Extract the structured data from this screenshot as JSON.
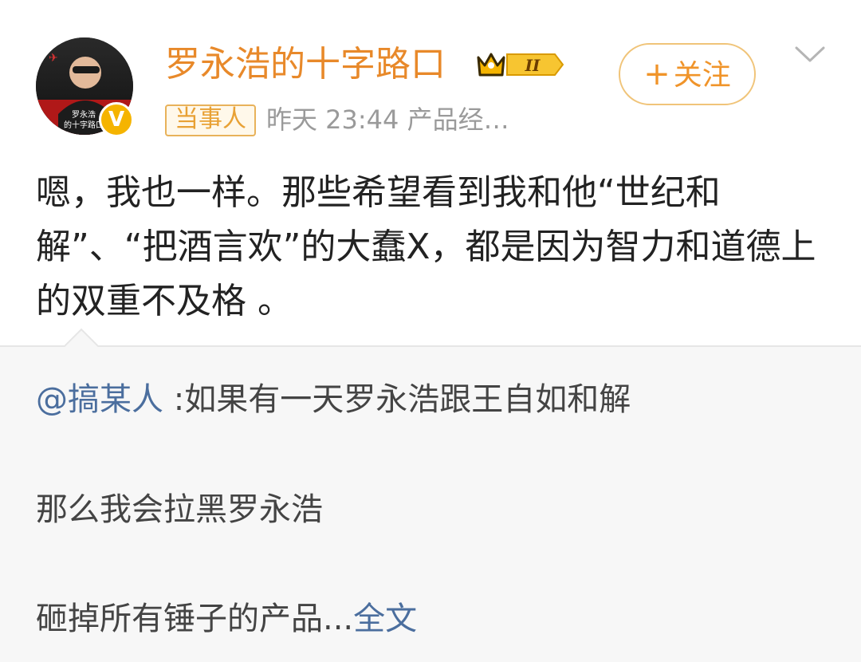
{
  "author": {
    "name": "罗永浩的十字路口",
    "avatar_caption_line1": "罗永浩",
    "avatar_caption_line2": "的十字路口",
    "verified_mark": "V",
    "vip_level": "II",
    "role_tag": "当事人",
    "post_time_source": "昨天 23:44 产品经…"
  },
  "follow": {
    "plus": "+",
    "label": "关注"
  },
  "post": {
    "text": "嗯，我也一样。那些希望看到我和他“世纪和解”、“把酒言欢”的大蠢X，都是因为智力和道德上的双重不及格 。"
  },
  "repost": {
    "mention": "@搞某人",
    "line1_rest": " :如果有一天罗永浩跟王自如和解",
    "line2": "那么我会拉黑罗永浩",
    "line3": "砸掉所有锤子的产品...",
    "full_text_link": "全文"
  },
  "watermark": "",
  "icons": {
    "more": "chevron-down-icon",
    "vip": "crown-icon",
    "verified": "verified-v-icon"
  },
  "colors": {
    "username": "#e8892a",
    "link": "#4b6e9e",
    "tag_border": "#e8b25a",
    "follow_border": "#f0c479",
    "repost_bg": "#f7f7f7"
  }
}
